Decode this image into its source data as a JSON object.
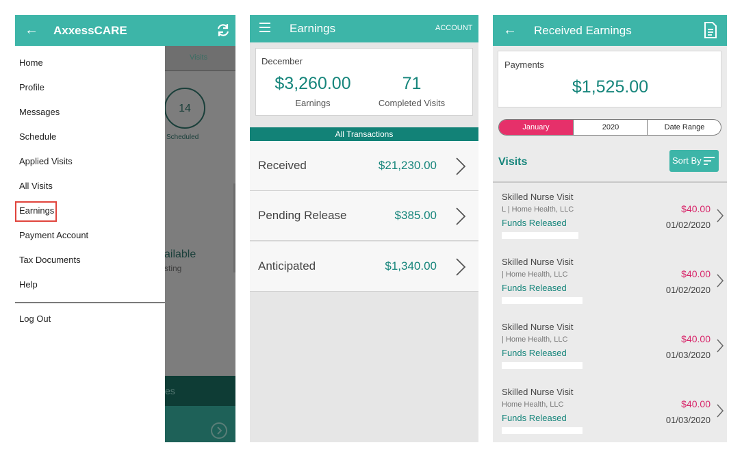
{
  "left_screen": {
    "app_title": "AxxessCARE",
    "background": {
      "tab_label": "Visits",
      "scheduled_count": "14",
      "scheduled_label": "Scheduled",
      "available_fragment": "ailable",
      "posting_fragment": "sting",
      "band_fragment": "es"
    },
    "menu": {
      "items": [
        {
          "label": "Home"
        },
        {
          "label": "Profile"
        },
        {
          "label": "Messages"
        },
        {
          "label": "Schedule"
        },
        {
          "label": "Applied Visits"
        },
        {
          "label": "All Visits"
        },
        {
          "label": "Earnings",
          "highlighted": true
        },
        {
          "label": "Payment Account"
        },
        {
          "label": "Tax Documents"
        },
        {
          "label": "Help"
        }
      ],
      "logout_label": "Log Out"
    },
    "icons": [
      "back-arrow-icon",
      "refresh-icon",
      "chevron-right-circle-icon"
    ]
  },
  "middle_screen": {
    "title": "Earnings",
    "account_label": "ACCOUNT",
    "summary": {
      "month": "December",
      "earnings_amount": "$3,260.00",
      "earnings_label": "Earnings",
      "visits_count": "71",
      "visits_label": "Completed Visits"
    },
    "all_transactions_label": "All Transactions",
    "transactions": [
      {
        "label": "Received",
        "amount": "$21,230.00"
      },
      {
        "label": "Pending Release",
        "amount": "$385.00"
      },
      {
        "label": "Anticipated",
        "amount": "$1,340.00"
      }
    ]
  },
  "right_screen": {
    "title": "Received Earnings",
    "payments_label": "Payments",
    "payments_amount": "$1,525.00",
    "filters": {
      "month": "January",
      "year": "2020",
      "date_range": "Date Range"
    },
    "visits_heading": "Visits",
    "sort_label": "Sort By",
    "visits": [
      {
        "title": "Skilled Nurse Visit",
        "agency": "L      | Home Health, LLC",
        "status": "Funds Released",
        "amount": "$40.00",
        "date": "01/02/2020"
      },
      {
        "title": "Skilled Nurse Visit",
        "agency": "       | Home Health, LLC",
        "status": "Funds Released",
        "amount": "$40.00",
        "date": "01/02/2020"
      },
      {
        "title": "Skilled Nurse Visit",
        "agency": "       | Home Health, LLC",
        "status": "Funds Released",
        "amount": "$40.00",
        "date": "01/03/2020"
      },
      {
        "title": "Skilled Nurse Visit",
        "agency": "        Home Health, LLC",
        "status": "Funds Released",
        "amount": "$40.00",
        "date": "01/03/2020"
      }
    ]
  },
  "colors": {
    "teal_header": "#3db5a8",
    "teal_text": "#16857b",
    "dark_teal_bar": "#128277",
    "accent_pink": "#e6306a",
    "highlight_red": "#e0443c"
  }
}
